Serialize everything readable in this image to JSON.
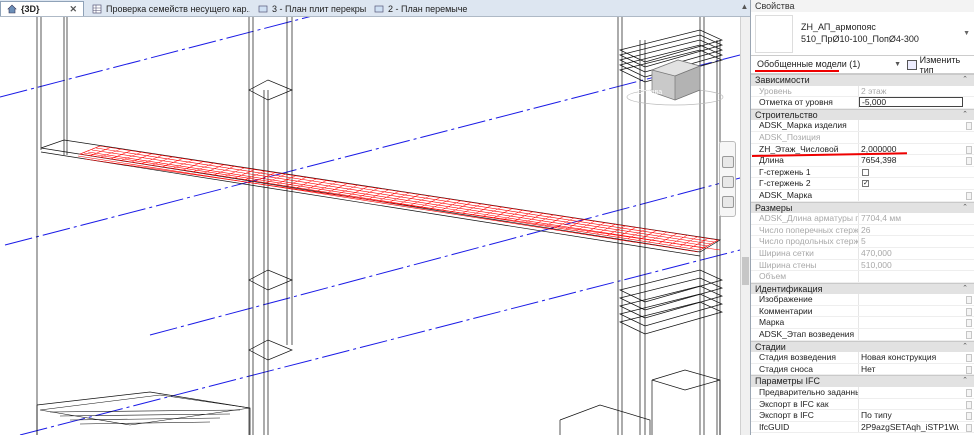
{
  "tabs": [
    {
      "label": "{3D}",
      "active": true
    },
    {
      "label": "Проверка семейств несущего кар...",
      "active": false
    },
    {
      "label": "3 - План плит перекрытия",
      "active": false
    },
    {
      "label": "2 - План перемычек",
      "active": false
    }
  ],
  "viewcube_label": "Справа",
  "properties": {
    "title": "Свойства",
    "type_family": "ZH_АП_армопояс",
    "type_name": "510_ПрØ10-100_ПопØ4-300",
    "filter": "Обобщенные модели (1)",
    "edit_type": "Изменить тип",
    "sections": [
      {
        "name": "Зависимости",
        "rows": [
          {
            "label": "Уровень",
            "value": "2 этаж",
            "dim": true
          },
          {
            "label": "Отметка от уровня",
            "value": "-5,000",
            "input": true
          }
        ]
      },
      {
        "name": "Строительство",
        "rows": [
          {
            "label": "ADSK_Марка изделия",
            "value": ""
          },
          {
            "label": "ADSK_Позиция",
            "value": "",
            "dim": true
          },
          {
            "label": "ZH_Этаж_Числовой",
            "value": "2,000000"
          },
          {
            "label": "Длина",
            "value": "7654,398"
          },
          {
            "label": "Г-стержень 1",
            "check": false
          },
          {
            "label": "Г-стержень 2",
            "check": true
          },
          {
            "label": "ADSK_Марка",
            "value": ""
          }
        ]
      },
      {
        "name": "Размеры",
        "rows": [
          {
            "label": "ADSK_Длина арматуры по ...",
            "value": "7704,4 мм",
            "dim": true
          },
          {
            "label": "Число поперечных стерж...",
            "value": "26",
            "dim": true
          },
          {
            "label": "Число продольных стерж...",
            "value": "5",
            "dim": true
          },
          {
            "label": "Ширина сетки",
            "value": "470,000",
            "dim": true
          },
          {
            "label": "Ширина стены",
            "value": "510,000",
            "dim": true
          },
          {
            "label": "Объем",
            "value": "",
            "dim": true
          }
        ]
      },
      {
        "name": "Идентификация",
        "rows": [
          {
            "label": "Изображение",
            "value": ""
          },
          {
            "label": "Комментарии",
            "value": ""
          },
          {
            "label": "Марка",
            "value": ""
          },
          {
            "label": "ADSK_Этап возведения",
            "value": ""
          }
        ]
      },
      {
        "name": "Стадии",
        "rows": [
          {
            "label": "Стадия возведения",
            "value": "Новая конструкция"
          },
          {
            "label": "Стадия сноса",
            "value": "Нет"
          }
        ]
      },
      {
        "name": "Параметры IFC",
        "rows": [
          {
            "label": "Предварительно заданный...",
            "value": ""
          },
          {
            "label": "Экспорт в IFC как",
            "value": ""
          },
          {
            "label": "Экспорт в IFC",
            "value": "По типу"
          },
          {
            "label": "IfcGUID",
            "value": "2P9azgSETAqh_iSTP1WuFl"
          }
        ]
      }
    ]
  },
  "colors": {
    "annotation": "#ee0000",
    "grid_lines": "#1a1ae6",
    "rebar": "#ff0000",
    "header_bg": "#dde6f1"
  }
}
